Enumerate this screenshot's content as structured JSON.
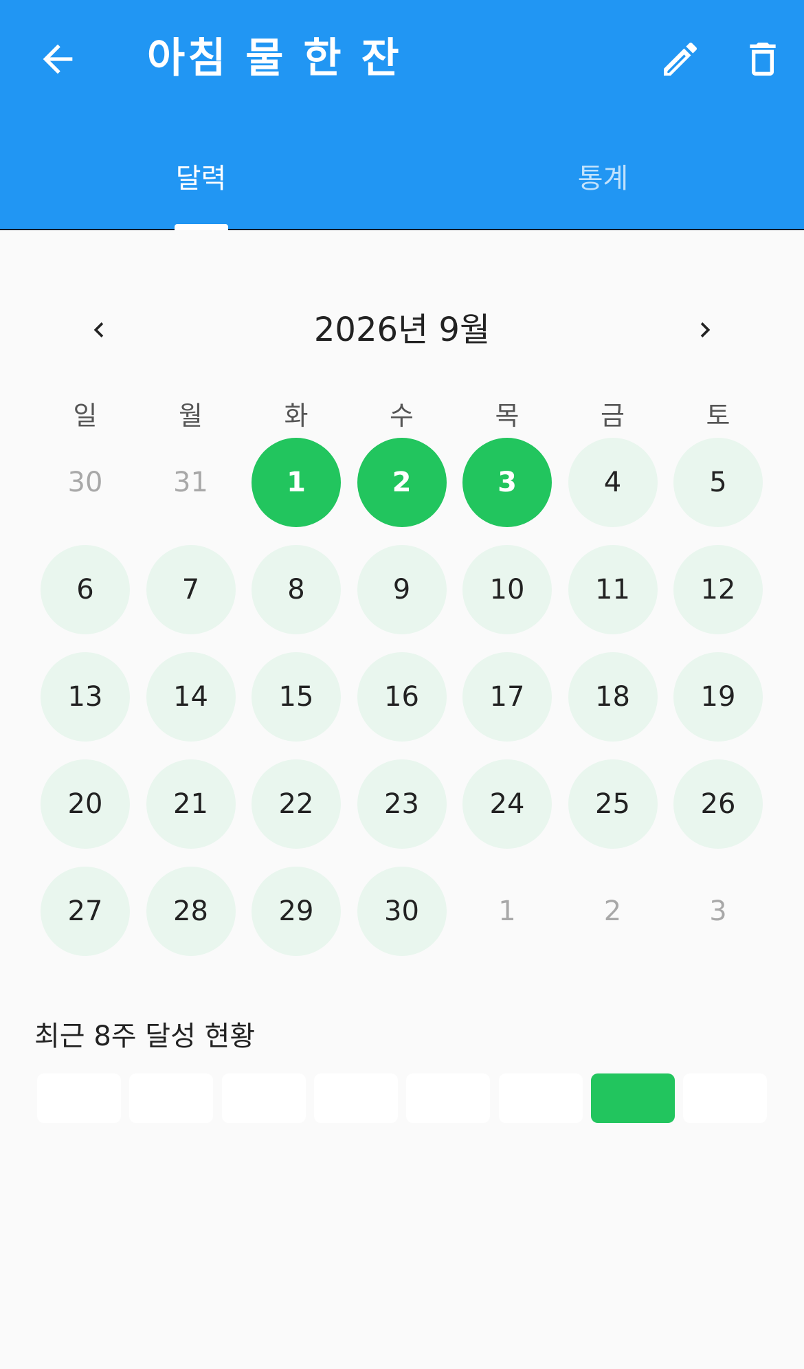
{
  "appbar": {
    "title": "아침 물 한 잔",
    "back_icon": "arrow-left-icon",
    "edit_icon": "pencil-icon",
    "delete_icon": "trash-icon"
  },
  "tabs": [
    {
      "label": "달력",
      "selected": true
    },
    {
      "label": "통계",
      "selected": false
    }
  ],
  "calendar": {
    "month_label": "2026년 9월",
    "weekdays": [
      "일",
      "월",
      "화",
      "수",
      "목",
      "금",
      "토"
    ],
    "days": [
      {
        "label": "30",
        "state": "other"
      },
      {
        "label": "31",
        "state": "other"
      },
      {
        "label": "1",
        "state": "done"
      },
      {
        "label": "2",
        "state": "done"
      },
      {
        "label": "3",
        "state": "done"
      },
      {
        "label": "4",
        "state": "cur"
      },
      {
        "label": "5",
        "state": "cur"
      },
      {
        "label": "6",
        "state": "cur"
      },
      {
        "label": "7",
        "state": "cur"
      },
      {
        "label": "8",
        "state": "cur"
      },
      {
        "label": "9",
        "state": "cur"
      },
      {
        "label": "10",
        "state": "cur"
      },
      {
        "label": "11",
        "state": "cur"
      },
      {
        "label": "12",
        "state": "cur"
      },
      {
        "label": "13",
        "state": "cur"
      },
      {
        "label": "14",
        "state": "cur"
      },
      {
        "label": "15",
        "state": "cur"
      },
      {
        "label": "16",
        "state": "cur"
      },
      {
        "label": "17",
        "state": "cur"
      },
      {
        "label": "18",
        "state": "cur"
      },
      {
        "label": "19",
        "state": "cur"
      },
      {
        "label": "20",
        "state": "cur"
      },
      {
        "label": "21",
        "state": "cur"
      },
      {
        "label": "22",
        "state": "cur"
      },
      {
        "label": "23",
        "state": "cur"
      },
      {
        "label": "24",
        "state": "cur"
      },
      {
        "label": "25",
        "state": "cur"
      },
      {
        "label": "26",
        "state": "cur"
      },
      {
        "label": "27",
        "state": "cur"
      },
      {
        "label": "28",
        "state": "cur"
      },
      {
        "label": "29",
        "state": "cur"
      },
      {
        "label": "30",
        "state": "cur"
      },
      {
        "label": "1",
        "state": "other"
      },
      {
        "label": "2",
        "state": "other"
      },
      {
        "label": "3",
        "state": "other"
      }
    ]
  },
  "weekly": {
    "title": "최근 8주 달성 현황",
    "weeks_done": [
      false,
      false,
      false,
      false,
      false,
      false,
      true,
      false
    ]
  },
  "colors": {
    "primary": "#2196f3",
    "done": "#22c55e",
    "current_day_bg": "#e9f6ee",
    "page_bg": "#fafafa"
  }
}
